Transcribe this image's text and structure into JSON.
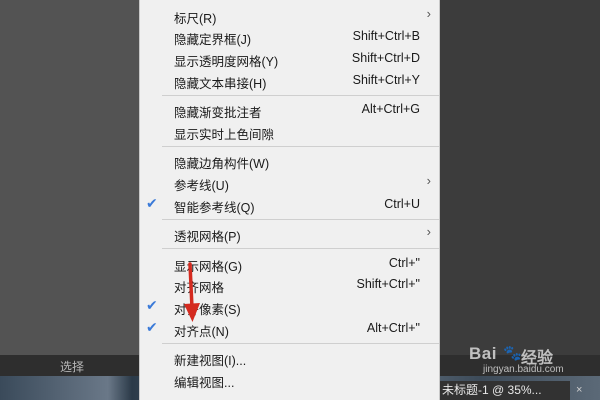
{
  "menu": {
    "items": [
      {
        "label": "标尺(R)",
        "shortcut": "",
        "checked": false,
        "submenu": true
      },
      {
        "label": "隐藏定界框(J)",
        "shortcut": "Shift+Ctrl+B",
        "checked": false,
        "submenu": false
      },
      {
        "label": "显示透明度网格(Y)",
        "shortcut": "Shift+Ctrl+D",
        "checked": false,
        "submenu": false
      },
      {
        "label": "隐藏文本串接(H)",
        "shortcut": "Shift+Ctrl+Y",
        "checked": false,
        "submenu": false
      },
      {
        "label": "隐藏渐变批注者",
        "shortcut": "Alt+Ctrl+G",
        "checked": false,
        "submenu": false
      },
      {
        "label": "显示实时上色间隙",
        "shortcut": "",
        "checked": false,
        "submenu": false
      },
      {
        "label": "隐藏边角构件(W)",
        "shortcut": "",
        "checked": false,
        "submenu": false
      },
      {
        "label": "参考线(U)",
        "shortcut": "",
        "checked": false,
        "submenu": true
      },
      {
        "label": "智能参考线(Q)",
        "shortcut": "Ctrl+U",
        "checked": true,
        "submenu": false
      },
      {
        "label": "透视网格(P)",
        "shortcut": "",
        "checked": false,
        "submenu": true
      },
      {
        "label": "显示网格(G)",
        "shortcut": "Ctrl+\"",
        "checked": false,
        "submenu": false
      },
      {
        "label": "对齐网格",
        "shortcut": "Shift+Ctrl+\"",
        "checked": false,
        "submenu": false
      },
      {
        "label": "对齐像素(S)",
        "shortcut": "",
        "checked": true,
        "submenu": false
      },
      {
        "label": "对齐点(N)",
        "shortcut": "Alt+Ctrl+\"",
        "checked": true,
        "submenu": false
      },
      {
        "label": "新建视图(I)...",
        "shortcut": "",
        "checked": false,
        "submenu": false
      },
      {
        "label": "编辑视图...",
        "shortcut": "",
        "checked": false,
        "submenu": false
      }
    ],
    "check_glyph": "✔",
    "arrow_glyph": "›"
  },
  "panel": {
    "select_label": "选择"
  },
  "document": {
    "tab_title": "未标题-1 @ 35%...",
    "close_glyph": "×"
  },
  "watermark": {
    "logo": "Bai",
    "paw": "🐾",
    "text": "经验",
    "url": "jingyan.baidu.com"
  },
  "colors": {
    "menu_bg": "#f0f0f0",
    "check": "#3a7ad8",
    "arrow": "#d42a1f",
    "bg": "#535353"
  }
}
